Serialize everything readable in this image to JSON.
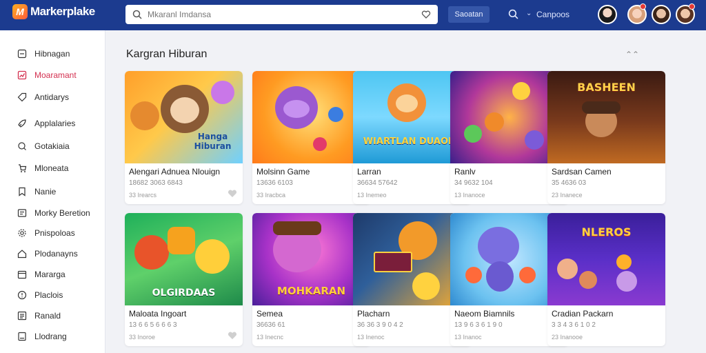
{
  "app": {
    "brand": "Markerplake",
    "search_placeholder": "Mkaranl Imdansa",
    "search_button": "Saoatan",
    "top_link": "Canpoos"
  },
  "sidebar": {
    "items": [
      {
        "label": "Hibnagan",
        "icon": "home-icon",
        "active": false
      },
      {
        "label": "Moaramant",
        "icon": "chart-icon",
        "active": true
      },
      {
        "label": "Antidarys",
        "icon": "tag-icon",
        "active": false
      },
      {
        "label": "Applalaries",
        "icon": "rocket-icon",
        "active": false
      },
      {
        "label": "Gotakiaia",
        "icon": "bag-icon",
        "active": false
      },
      {
        "label": "Mloneata",
        "icon": "cart-icon",
        "active": false
      },
      {
        "label": "Nanie",
        "icon": "bookmark-icon",
        "active": false
      },
      {
        "label": "Morky Beretion",
        "icon": "folder-icon",
        "active": false
      },
      {
        "label": "Pnispoloas",
        "icon": "gear-icon",
        "active": false
      },
      {
        "label": "Plodanayns",
        "icon": "house-icon",
        "active": false
      },
      {
        "label": "Mararga",
        "icon": "calendar-icon",
        "active": false
      },
      {
        "label": "Placlois",
        "icon": "shield-icon",
        "active": false
      },
      {
        "label": "Ranald",
        "icon": "list-icon",
        "active": false
      },
      {
        "label": "Llodrang",
        "icon": "document-icon",
        "active": false
      }
    ]
  },
  "main": {
    "section_title": "Kargran Hiburan",
    "cards": [
      {
        "title": "Alengari Adnuea Nlouign",
        "meta": "18682 3063 6843",
        "sub": "33 Irearcs",
        "thumb_label": "Hanga Hiburan",
        "liked": true
      },
      {
        "title": "Molsinn Game",
        "meta": "13636 6103",
        "sub": "33 Iracbca",
        "thumb_label": "",
        "liked": false
      },
      {
        "title": "Larran",
        "meta": "36634 57642",
        "sub": "13 Inemeo",
        "thumb_label": "WIARTLAN DUAOES",
        "liked": false
      },
      {
        "title": "Ranlv",
        "meta": "34 9632 104",
        "sub": "13 Inanoce",
        "thumb_label": "",
        "liked": false
      },
      {
        "title": "Sardsan Camen",
        "meta": "35 4636 03",
        "sub": "23 Inanece",
        "thumb_label": "BASHEEN",
        "liked": false
      },
      {
        "title": "Maloata Ingoart",
        "meta": "13 6 6 5 6 6 6 3",
        "sub": "33 Inoroe",
        "thumb_label": "OLGIRDAAS",
        "liked": true
      },
      {
        "title": "Semea",
        "meta": "36636 61",
        "sub": "13 Inecnc",
        "thumb_label": "MOHKARAN",
        "liked": false
      },
      {
        "title": "Placharn",
        "meta": "36 36 3 9 0 4 2",
        "sub": "13 Inenoc",
        "thumb_label": "",
        "liked": false
      },
      {
        "title": "Naeom Biamnils",
        "meta": "13 9 6 3 6 1 9 0",
        "sub": "13 Inanoc",
        "thumb_label": "",
        "liked": false
      },
      {
        "title": "Cradian Packarn",
        "meta": "3 3 4 3 6 1 0 2",
        "sub": "23 Inanooe",
        "thumb_label": "NLEROS",
        "liked": false
      }
    ]
  }
}
